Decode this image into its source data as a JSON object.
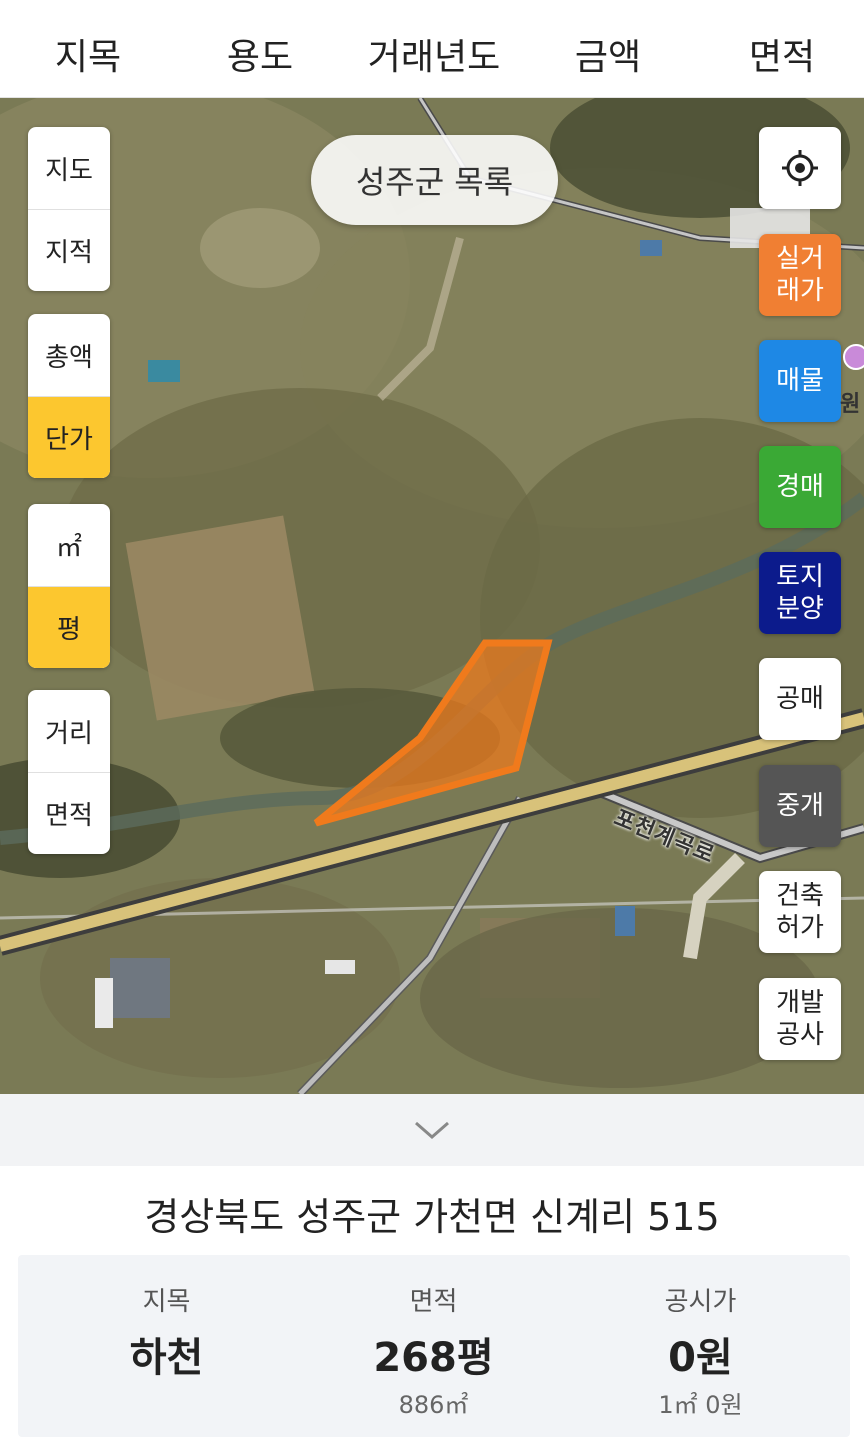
{
  "tabs": [
    "지목",
    "용도",
    "거래년도",
    "금액",
    "면적"
  ],
  "map": {
    "list_button": "성주군 목록",
    "map_type": [
      "지도",
      "지적"
    ],
    "price_mode": [
      "총액",
      "단가"
    ],
    "price_mode_selected": "단가",
    "unit": [
      "㎡",
      "평"
    ],
    "unit_selected": "평",
    "measure": [
      "거리",
      "면적"
    ],
    "right_buttons": [
      {
        "label": "실거\n래가",
        "bg": "#f07f33",
        "fg": "#ffffff"
      },
      {
        "label": "매물",
        "bg": "#1e88e5",
        "fg": "#ffffff"
      },
      {
        "label": "경매",
        "bg": "#3aa935",
        "fg": "#ffffff"
      },
      {
        "label": "토지\n분양",
        "bg": "#0c1b8c",
        "fg": "#ffffff"
      },
      {
        "label": "공매",
        "bg": "#ffffff",
        "fg": "#222222"
      },
      {
        "label": "중개",
        "bg": "#555555",
        "fg": "#ffffff"
      },
      {
        "label": "건축\n허가",
        "bg": "#ffffff",
        "fg": "#222222"
      },
      {
        "label": "개발\n공사",
        "bg": "#ffffff",
        "fg": "#222222"
      }
    ],
    "road_label": "포천계곡로",
    "edge_label": "원",
    "parcel_color": "#f07a1c"
  },
  "parcel": {
    "address": "경상북도 성주군 가천면 신계리 515",
    "items": [
      {
        "label": "지목",
        "value": "하천",
        "sub": ""
      },
      {
        "label": "면적",
        "value": "268평",
        "sub": "886㎡"
      },
      {
        "label": "공시가",
        "value": "0원",
        "sub": "1㎡ 0원"
      }
    ]
  }
}
